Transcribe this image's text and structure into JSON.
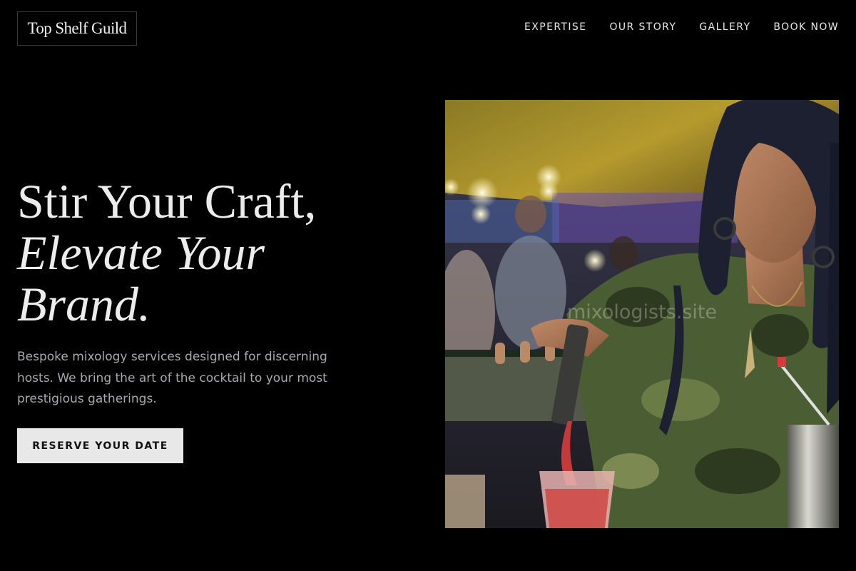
{
  "header": {
    "logo": "Top Shelf Guild",
    "nav": [
      {
        "label": "EXPERTISE"
      },
      {
        "label": "OUR STORY"
      },
      {
        "label": "GALLERY"
      },
      {
        "label": "BOOK NOW"
      }
    ]
  },
  "hero": {
    "title_line1": "Stir Your Craft,",
    "title_line2": "Elevate Your",
    "title_line3": "Brand.",
    "description": "Bespoke mixology services designed for discerning hosts. We bring the art of the cocktail to your most prestigious gatherings.",
    "cta_label": "RESERVE YOUR DATE",
    "image": {
      "subject": "bartender-pouring-cocktail-photo",
      "watermark": "mixologists.site"
    }
  },
  "colors": {
    "background": "#000000",
    "text": "#ececec",
    "muted_text": "#a9a9ae",
    "cta_background": "#e8e8e8",
    "cta_text": "#111111"
  }
}
